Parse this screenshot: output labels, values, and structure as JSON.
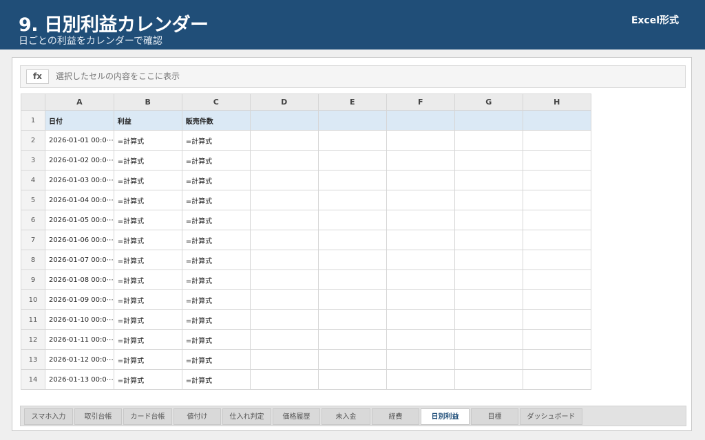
{
  "header": {
    "title": "9. 日別利益カレンダー",
    "subtitle": "日ごとの利益をカレンダーで確認",
    "mode": "Excel形式"
  },
  "formula_bar": {
    "fx_label": "fx",
    "placeholder": "選択したセルの内容をここに表示"
  },
  "grid": {
    "columns": [
      "A",
      "B",
      "C",
      "D",
      "E",
      "F",
      "G",
      "H"
    ],
    "header_row": {
      "row": "1",
      "cells": [
        "日付",
        "利益",
        "販売件数",
        "",
        "",
        "",
        "",
        ""
      ]
    },
    "rows": [
      {
        "row": "2",
        "cells": [
          "2026-01-01 00:0⋯",
          "=計算式",
          "=計算式",
          "",
          "",
          "",
          "",
          ""
        ]
      },
      {
        "row": "3",
        "cells": [
          "2026-01-02 00:0⋯",
          "=計算式",
          "=計算式",
          "",
          "",
          "",
          "",
          ""
        ]
      },
      {
        "row": "4",
        "cells": [
          "2026-01-03 00:0⋯",
          "=計算式",
          "=計算式",
          "",
          "",
          "",
          "",
          ""
        ]
      },
      {
        "row": "5",
        "cells": [
          "2026-01-04 00:0⋯",
          "=計算式",
          "=計算式",
          "",
          "",
          "",
          "",
          ""
        ]
      },
      {
        "row": "6",
        "cells": [
          "2026-01-05 00:0⋯",
          "=計算式",
          "=計算式",
          "",
          "",
          "",
          "",
          ""
        ]
      },
      {
        "row": "7",
        "cells": [
          "2026-01-06 00:0⋯",
          "=計算式",
          "=計算式",
          "",
          "",
          "",
          "",
          ""
        ]
      },
      {
        "row": "8",
        "cells": [
          "2026-01-07 00:0⋯",
          "=計算式",
          "=計算式",
          "",
          "",
          "",
          "",
          ""
        ]
      },
      {
        "row": "9",
        "cells": [
          "2026-01-08 00:0⋯",
          "=計算式",
          "=計算式",
          "",
          "",
          "",
          "",
          ""
        ]
      },
      {
        "row": "10",
        "cells": [
          "2026-01-09 00:0⋯",
          "=計算式",
          "=計算式",
          "",
          "",
          "",
          "",
          ""
        ]
      },
      {
        "row": "11",
        "cells": [
          "2026-01-10 00:0⋯",
          "=計算式",
          "=計算式",
          "",
          "",
          "",
          "",
          ""
        ]
      },
      {
        "row": "12",
        "cells": [
          "2026-01-11 00:0⋯",
          "=計算式",
          "=計算式",
          "",
          "",
          "",
          "",
          ""
        ]
      },
      {
        "row": "13",
        "cells": [
          "2026-01-12 00:0⋯",
          "=計算式",
          "=計算式",
          "",
          "",
          "",
          "",
          ""
        ]
      },
      {
        "row": "14",
        "cells": [
          "2026-01-13 00:0⋯",
          "=計算式",
          "=計算式",
          "",
          "",
          "",
          "",
          ""
        ]
      }
    ]
  },
  "tabs": [
    {
      "label": "スマホ入力",
      "active": false
    },
    {
      "label": "取引台帳",
      "active": false
    },
    {
      "label": "カード台帳",
      "active": false
    },
    {
      "label": "値付け",
      "active": false
    },
    {
      "label": "仕入れ判定",
      "active": false
    },
    {
      "label": "価格履歴",
      "active": false
    },
    {
      "label": "未入金",
      "active": false
    },
    {
      "label": "経費",
      "active": false
    },
    {
      "label": "日別利益",
      "active": true
    },
    {
      "label": "目標",
      "active": false
    },
    {
      "label": "ダッシュボード",
      "active": false
    }
  ]
}
